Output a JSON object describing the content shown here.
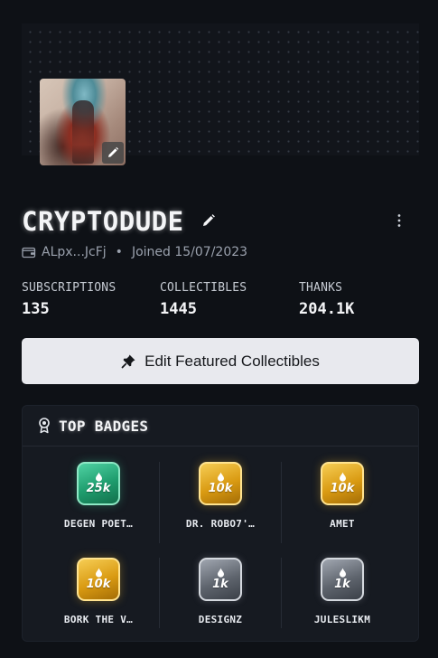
{
  "profile": {
    "username": "CRYPTODUDE",
    "wallet_short": "ALpx...JcFj",
    "joined": "Joined 15/07/2023"
  },
  "stats": [
    {
      "label": "SUBSCRIPTIONS",
      "value": "135"
    },
    {
      "label": "COLLECTIBLES",
      "value": "1445"
    },
    {
      "label": "THANKS",
      "value": "204.1K"
    }
  ],
  "actions": {
    "edit_featured_label": "Edit Featured Collectibles"
  },
  "top_badges": {
    "title": "TOP BADGES",
    "items": [
      {
        "amount": "25k",
        "name": "DEGEN POET…",
        "tier": "green"
      },
      {
        "amount": "10k",
        "name": "DR. ROBO7'…",
        "tier": "gold"
      },
      {
        "amount": "10k",
        "name": "AMET",
        "tier": "gold"
      },
      {
        "amount": "10k",
        "name": "BORK THE V…",
        "tier": "gold"
      },
      {
        "amount": "1k",
        "name": "DESIGNZ",
        "tier": "silver"
      },
      {
        "amount": "1k",
        "name": "JULESLIKM",
        "tier": "silver"
      }
    ]
  },
  "icons": {
    "avatar_edit": "pencil-icon",
    "name_edit": "pencil-icon",
    "menu": "more-vertical-icon",
    "wallet": "wallet-icon",
    "pin": "pin-icon",
    "badge_section": "award-icon",
    "badge_symbol": "drop-icon"
  },
  "colors": {
    "background": "#0e1116",
    "button_bg": "#e8e9ee",
    "badge_green": "#1e9c6d",
    "badge_gold": "#d99a12",
    "badge_silver": "#5e646d"
  }
}
